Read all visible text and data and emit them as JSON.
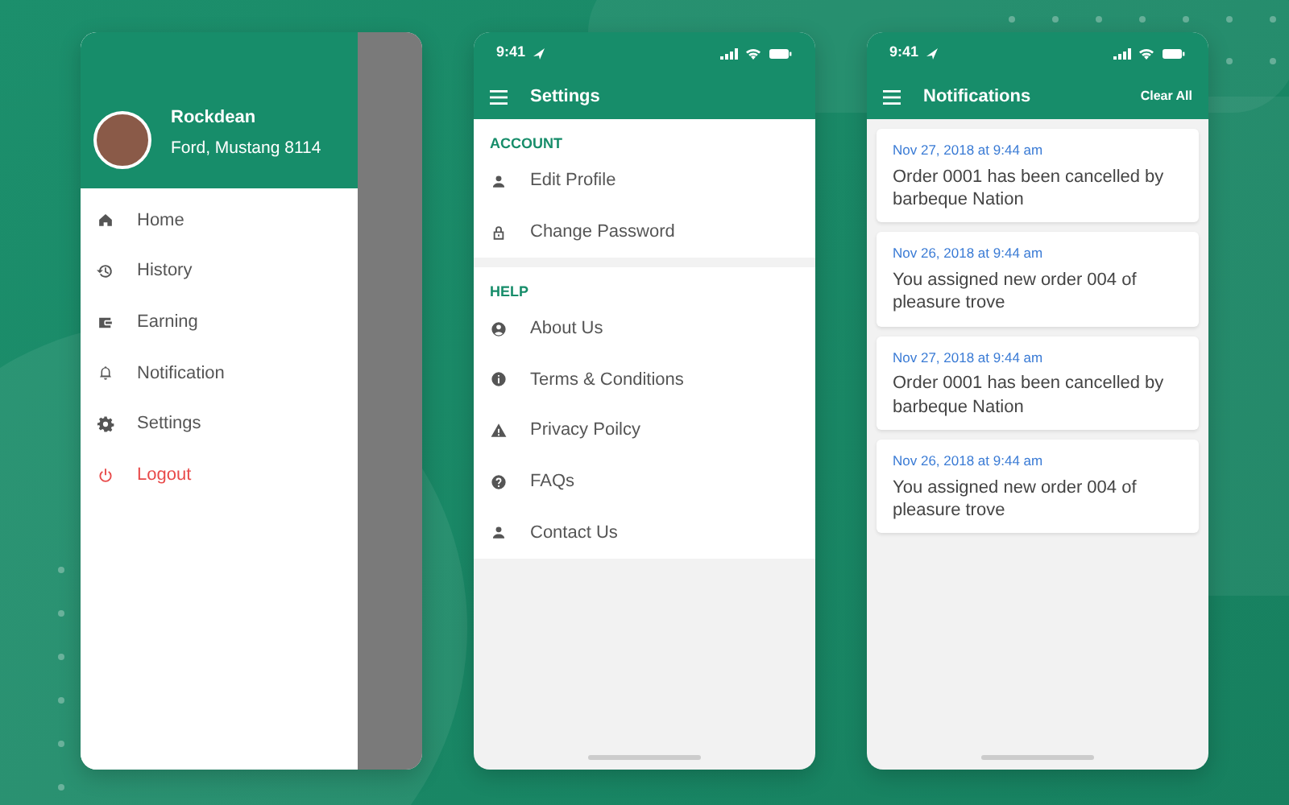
{
  "drawer_screen": {
    "profile": {
      "name": "Rockdean",
      "vehicle": "Ford, Mustang 8114"
    },
    "menu": [
      {
        "label": "Home",
        "kind": "link"
      },
      {
        "label": "History",
        "kind": "link"
      },
      {
        "label": "Earning",
        "kind": "link"
      },
      {
        "label": "Notification",
        "kind": "link"
      },
      {
        "label": "Settings",
        "kind": "link"
      },
      {
        "label": "Logout",
        "kind": "danger"
      }
    ]
  },
  "settings_screen": {
    "status_bar": {
      "time": "9:41"
    },
    "title": "Settings",
    "sections": [
      {
        "heading": "ACCOUNT",
        "items": [
          "Edit Profile",
          "Change Password"
        ]
      },
      {
        "heading": "HELP",
        "items": [
          "About Us",
          "Terms & Conditions",
          "Privacy Poilcy",
          "FAQs",
          "Contact Us"
        ]
      }
    ]
  },
  "notifications_screen": {
    "status_bar": {
      "time": "9:41"
    },
    "title": "Notifications",
    "action": "Clear All",
    "notifications": [
      {
        "time": "Nov 27, 2018 at 9:44 am",
        "message": "Order 0001 has been cancelled by barbeque Nation"
      },
      {
        "time": "Nov 26, 2018 at 9:44 am",
        "message": "You assigned new order 004 of pleasure trove"
      },
      {
        "time": "Nov 27, 2018 at 9:44 am",
        "message": "Order 0001 has been cancelled by barbeque Nation"
      },
      {
        "time": "Nov 26, 2018 at 9:44 am",
        "message": "You assigned new order 004 of pleasure trove"
      }
    ]
  }
}
